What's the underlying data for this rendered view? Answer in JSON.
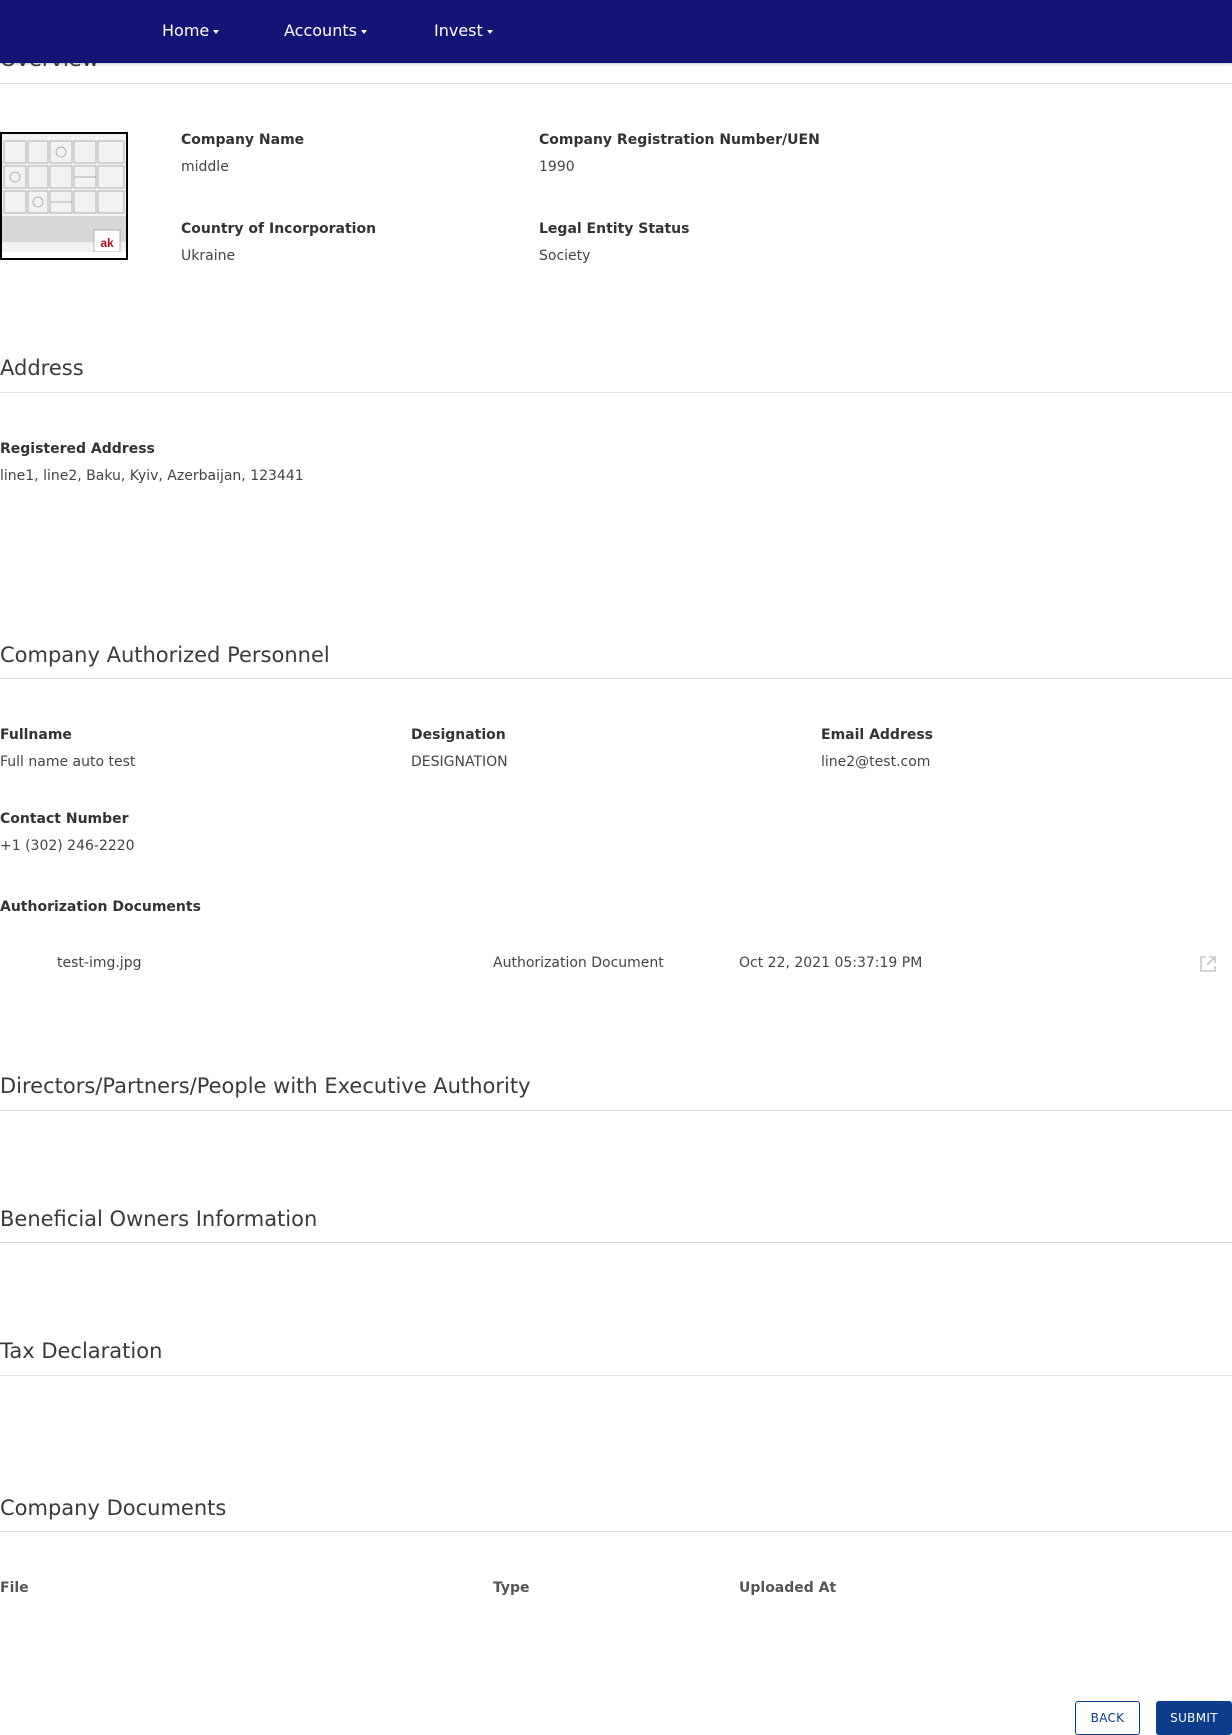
{
  "nav": {
    "home": "Home",
    "accounts": "Accounts",
    "invest": "Invest"
  },
  "overview": {
    "title": "Overview",
    "company_name_label": "Company Name",
    "company_name": "middle",
    "registration_label": "Company Registration Number/UEN",
    "registration": "1990",
    "country_label": "Country of Incorporation",
    "country": "Ukraine",
    "status_label": "Legal Entity Status",
    "status": "Society"
  },
  "address": {
    "title": "Address",
    "registered_label": "Registered Address",
    "registered": "line1, line2, Baku, Kyiv, Azerbaijan, 123441"
  },
  "personnel": {
    "title": "Company Authorized Personnel",
    "fullname_label": "Fullname",
    "fullname": "Full name auto test",
    "designation_label": "Designation",
    "designation": "DESIGNATION",
    "email_label": "Email Address",
    "email": "line2@test.com",
    "contact_label": "Contact Number",
    "contact": "+1 (302) 246-2220",
    "docs_label": "Authorization Documents",
    "docs": [
      {
        "file": "test-img.jpg",
        "type": "Authorization Document",
        "uploaded": "Oct 22, 2021 05:37:19 PM",
        "icon": "external-link-icon"
      }
    ]
  },
  "directors": {
    "title": "Directors/Partners/People with Executive Authority"
  },
  "beneficial": {
    "title": "Beneficial Owners Information"
  },
  "tax": {
    "title": "Tax Declaration"
  },
  "company_docs": {
    "title": "Company Documents",
    "columns": [
      "File",
      "Type",
      "Uploaded At"
    ]
  },
  "actions": {
    "back": "BACK",
    "submit": "SUBMIT"
  },
  "colors": {
    "navbar": "#141477",
    "primary": "#0d3c8c"
  }
}
